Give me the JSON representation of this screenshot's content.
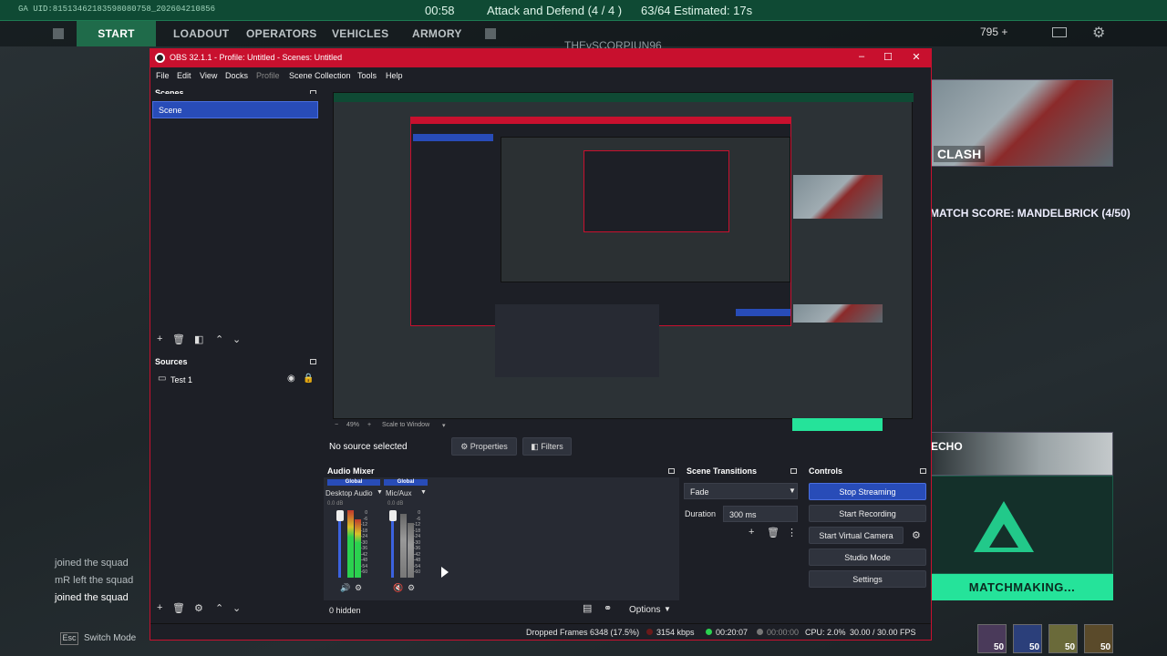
{
  "game": {
    "hud_id": "GA UID:8151346218359808​0758_202604210856",
    "timer": "00:58",
    "mode": "Attack and Defend (4 / 4 )",
    "count": "63/64 Estimated: 17s",
    "nav": [
      "START",
      "LOADOUT",
      "OPERATORS",
      "VEHICLES",
      "ARMORY"
    ],
    "coins": "795 +",
    "player": "THEvSCORPIUN96",
    "clash": "CLASH",
    "match_score": "MATCH SCORE: MANDELBRICK (4/50)",
    "echo": "ECHO",
    "matchmaking": "MATCHMAKING...",
    "perk_nums": [
      "50",
      "50",
      "50",
      "50"
    ],
    "chat": [
      "joined the squad",
      "mR left the squad",
      "joined the squad"
    ],
    "switch_mode": "Switch Mode",
    "esc": "Esc"
  },
  "obs": {
    "title": "OBS 32.1.1 - Profile: Untitled - Scenes: Untitled",
    "menu": [
      "File",
      "Edit",
      "View",
      "Docks",
      "Profile",
      "Scene Collection",
      "Tools",
      "Help"
    ],
    "scenes_title": "Scenes",
    "scene_item": "Scene",
    "sources_title": "Sources",
    "source_item": "Test 1",
    "zoom": "49%",
    "scale_mode": "Scale to Window",
    "no_source": "No source selected",
    "properties": "Properties",
    "filters": "Filters",
    "mixer_title": "Audio Mixer",
    "global": "Global",
    "channel_1": "Desktop Audio",
    "channel_2": "Mic/Aux",
    "db_1": "0.0 dB",
    "db_2": "0.0 dB",
    "scale": [
      "0",
      "-6",
      "-12",
      "-18",
      "-24",
      "-30",
      "-36",
      "-42",
      "-48",
      "-54",
      "-60"
    ],
    "hidden": "0 hidden",
    "options": "Options",
    "transitions_title": "Scene Transitions",
    "transition": "Fade",
    "duration_label": "Duration",
    "duration": "300 ms",
    "controls_title": "Controls",
    "stop_streaming": "Stop Streaming",
    "start_recording": "Start Recording",
    "start_vcam": "Start Virtual Camera",
    "studio_mode": "Studio Mode",
    "settings": "Settings",
    "status": {
      "dropped": "Dropped Frames 6348 (17.5%)",
      "kbps": "3154 kbps",
      "stream_time": "00:20:07",
      "rec_time": "00:00:00",
      "cpu": "CPU: 2.0%",
      "fps": "30.00 / 30.00 FPS"
    }
  }
}
